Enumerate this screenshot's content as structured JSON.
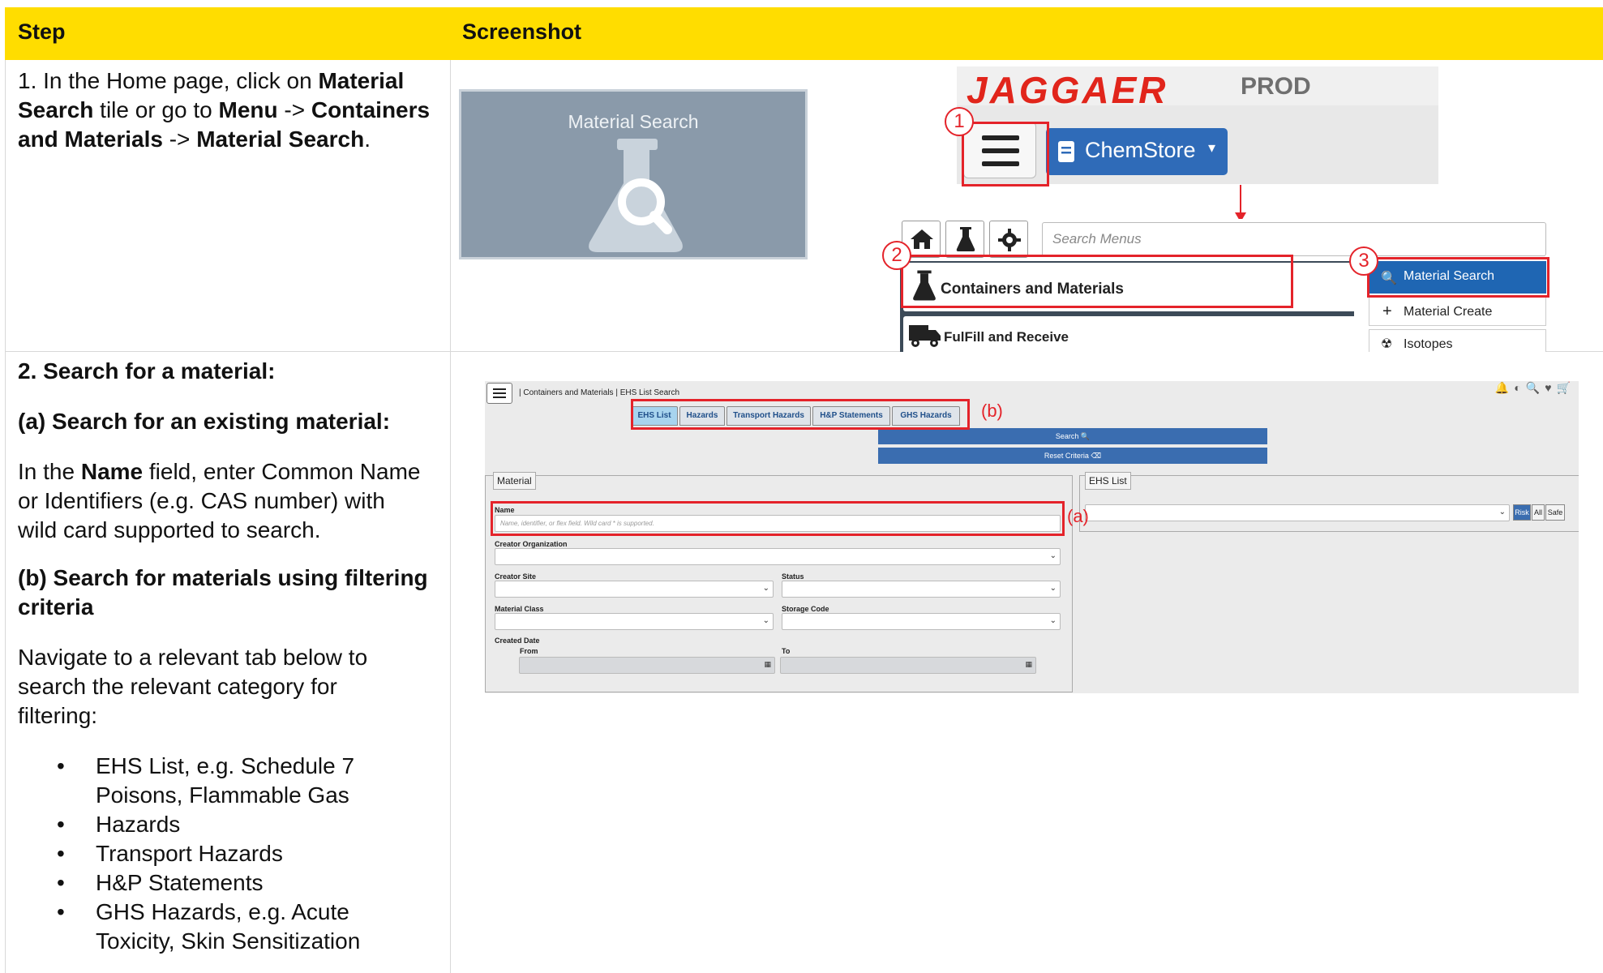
{
  "header": {
    "col_step": "Step",
    "col_screenshot": "Screenshot"
  },
  "step1": {
    "line1_pre": "1. In the Home page, click on ",
    "line1_bold": "Material",
    "line2_bold": "Search",
    "line2_mid": " tile or go to ",
    "line2_bold2": "Menu",
    "line2_arrow": " -> ",
    "line2_bold3": "Containers",
    "line3_bold": "and Materials",
    "line3_arrow": " -> ",
    "line3_bold2": "Material Search",
    "line3_end": "."
  },
  "tile": {
    "title": "Material Search",
    "icon": "flask-search-icon"
  },
  "jaggaer": {
    "logo": "JAGGAER",
    "env": "PROD",
    "app_button": "ChemStore",
    "callouts": [
      "1",
      "2",
      "3"
    ]
  },
  "menu": {
    "search_placeholder": "Search Menus",
    "items": [
      "Containers and Materials",
      "FulFill and Receive"
    ],
    "submenu": [
      "Material Search",
      "Material Create",
      "Isotopes"
    ]
  },
  "step2": {
    "heading": "2. Search for a material:",
    "sub_a": "(a) Search for an existing material:",
    "para_a_pre": "In the ",
    "para_a_bold": "Name",
    "para_a_post1": " field, enter Common Name",
    "para_a_post2": "or Identifiers (e.g. CAS number) with",
    "para_a_post3": "wild card supported to search.",
    "sub_b1": "(b) Search for materials using filtering",
    "sub_b2": "criteria",
    "para_b1": "Navigate to a relevant tab below to",
    "para_b2": "search the relevant category for",
    "para_b3": "filtering:",
    "bullets": [
      [
        "EHS List, e.g. Schedule 7",
        "Poisons, Flammable Gas"
      ],
      [
        "Hazards"
      ],
      [
        "Transport Hazards"
      ],
      [
        "H&P Statements"
      ],
      [
        "GHS Hazards, e.g. Acute",
        "Toxicity, Skin Sensitization"
      ]
    ]
  },
  "ehs": {
    "breadcrumb": "|  Containers and Materials  |  EHS List Search",
    "tabs": [
      "EHS List",
      "Hazards",
      "Transport Hazards",
      "H&P Statements",
      "GHS Hazards"
    ],
    "search_btn": "Search 🔍",
    "reset_btn": "Reset Criteria ⌫",
    "material_legend": "Material",
    "ehs_legend": "EHS List",
    "name_label": "Name",
    "name_placeholder": "Name, identifier, or flex field.   Wild card  *  is supported.",
    "creator_org": "Creator Organization",
    "creator_site": "Creator Site",
    "status": "Status",
    "material_class": "Material Class",
    "storage_code": "Storage Code",
    "created_date": "Created Date",
    "from": "From",
    "to": "To",
    "risk": "Risk",
    "all": "All",
    "safe": "Safe",
    "label_a": "(a)",
    "label_b": "(b)"
  },
  "colors": {
    "header": "#ffdd00",
    "callout": "#e4232a",
    "brand_blue": "#2f6bb8"
  }
}
